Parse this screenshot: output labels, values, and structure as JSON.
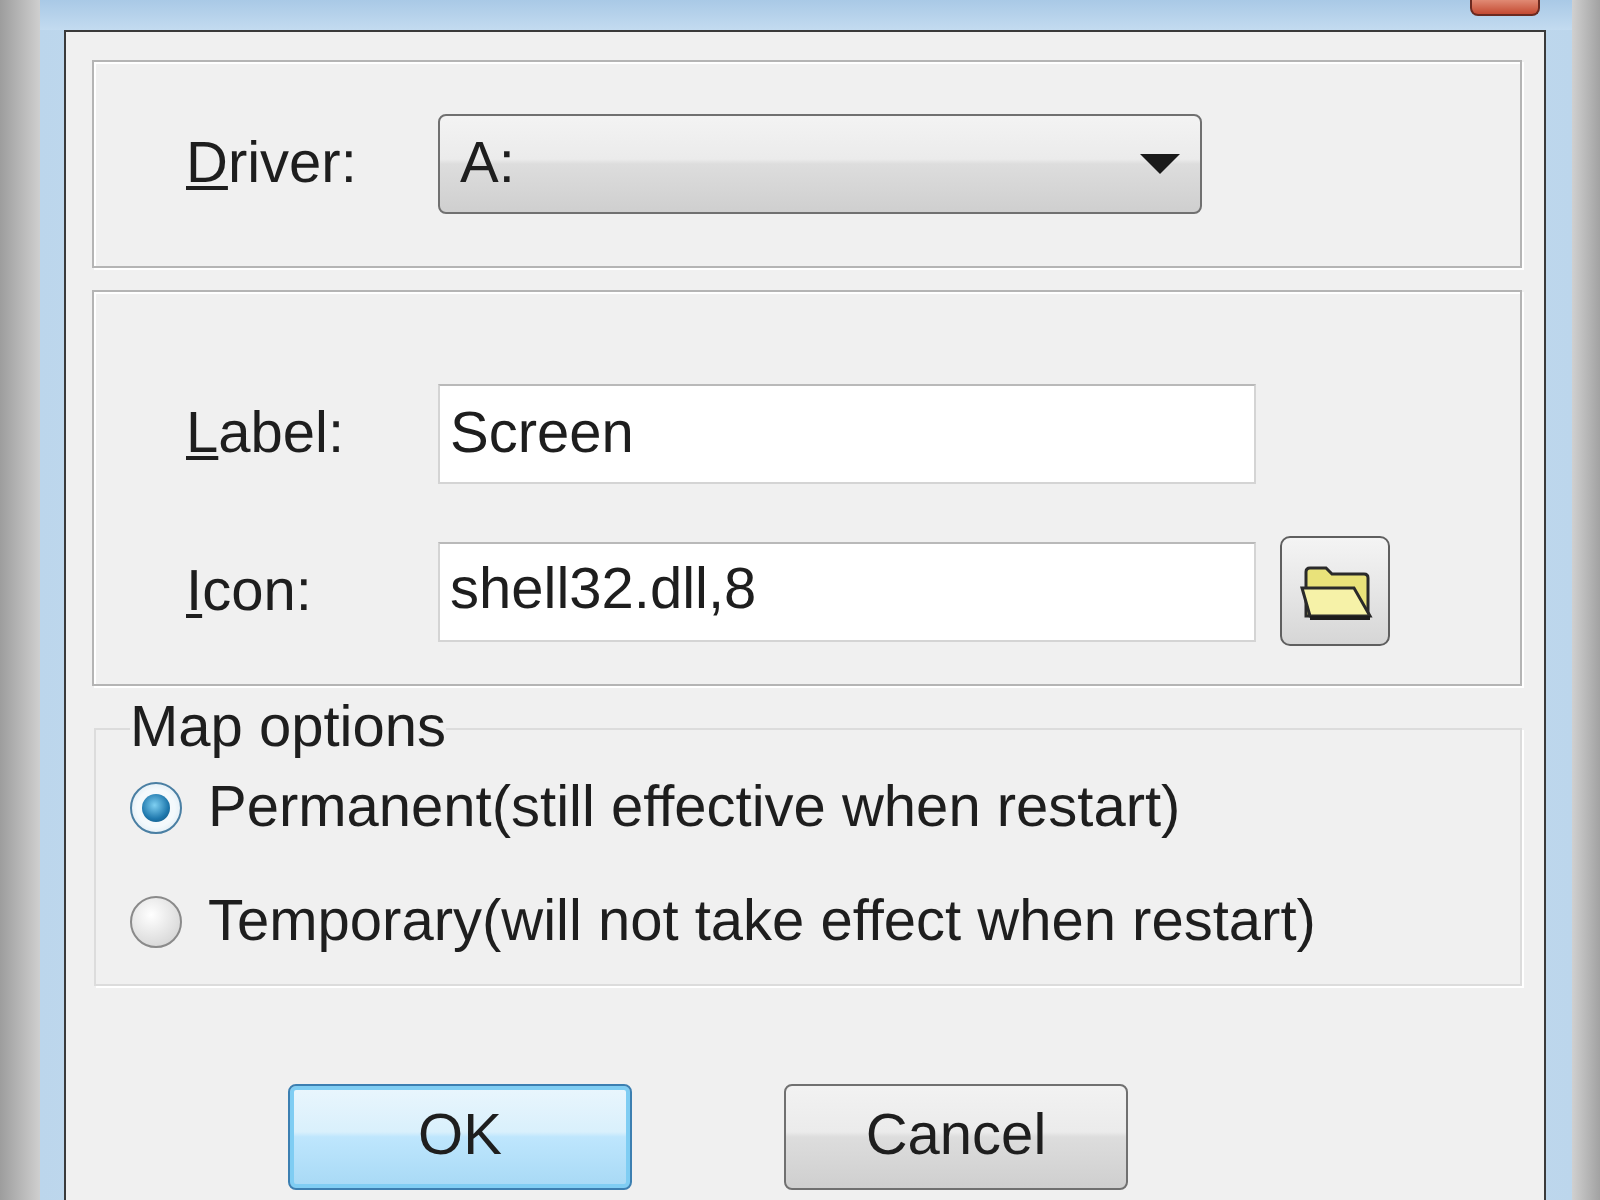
{
  "driver": {
    "label": "Driver:",
    "value": "A:"
  },
  "fields": [
    {
      "kind": "text",
      "label": "Label:",
      "value": "Screen"
    },
    {
      "kind": "browse",
      "label": "Icon:",
      "value": "shell32.dll,8"
    }
  ],
  "map_options": {
    "title": "Map options",
    "options": [
      {
        "label": "Permanent(still effective when restart)",
        "selected": true
      },
      {
        "label": "Temporary(will not take effect when restart)",
        "selected": false
      }
    ]
  },
  "buttons": [
    {
      "label": "OK",
      "default": true
    },
    {
      "label": "Cancel",
      "default": false
    }
  ]
}
